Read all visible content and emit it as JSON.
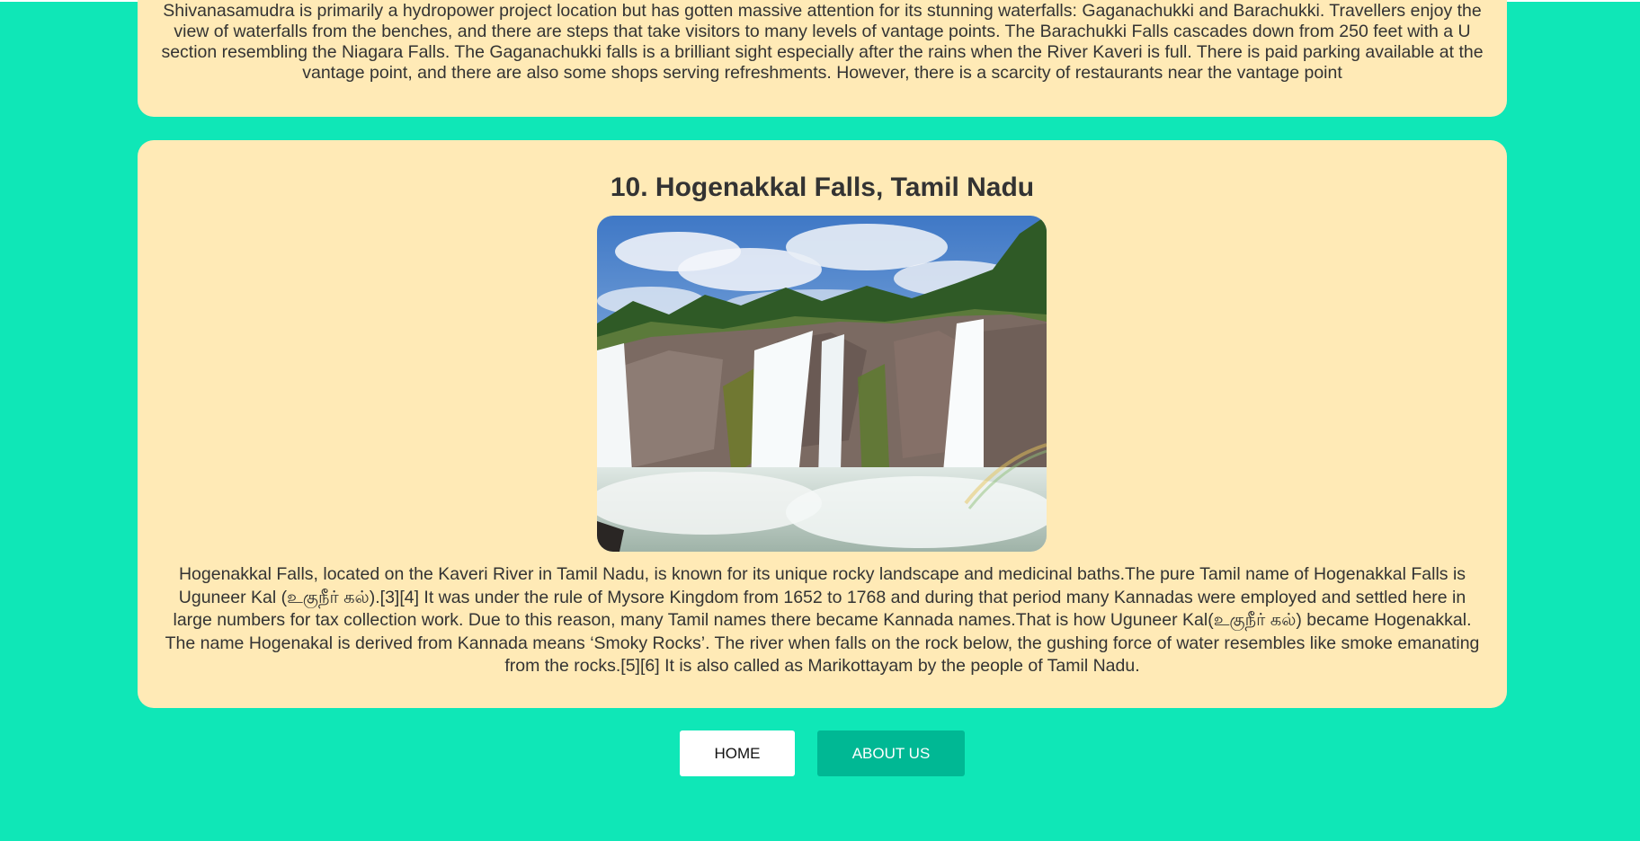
{
  "previous_section": {
    "text": "Shivanasamudra is primarily a hydropower project location but has gotten massive attention for its stunning waterfalls: Gaganachukki and Barachukki. Travellers enjoy the view of waterfalls from the benches, and there are steps that take visitors to many levels of vantage points. The Barachukki Falls cascades down from 250 feet with a U section resembling the Niagara Falls. The Gaganachukki falls is a brilliant sight especially after the rains when the River Kaveri is full. There is paid parking available at the vantage point, and there are also some shops serving refreshments. However, there is a scarcity of restaurants near the vantage point"
  },
  "section": {
    "title": "10. Hogenakkal Falls, Tamil Nadu",
    "text": "Hogenakkal Falls, located on the Kaveri River in Tamil Nadu, is known for its unique rocky landscape and medicinal baths.The pure Tamil name of Hogenakkal Falls is Uguneer Kal (உகுநீர் கல்).[3][4] It was under the rule of Mysore Kingdom from 1652 to 1768 and during that period many Kannadas were employed and settled here in large numbers for tax collection work. Due to this reason, many Tamil names there became Kannada names.That is how Uguneer Kal(உகுநீர் கல்) became Hogenakkal. The name Hogenakal is derived from Kannada means ‘Smoky Rocks’. The river when falls on the rock below, the gushing force of water resembles like smoke emanating from the rocks.[5][6] It is also called as Marikottayam by the people of Tamil Nadu."
  },
  "nav": {
    "home_label": "HOME",
    "about_label": "ABOUT US"
  },
  "colors": {
    "background": "#0fe7b7",
    "card": "#ffeab6",
    "about_button": "#00b894"
  }
}
